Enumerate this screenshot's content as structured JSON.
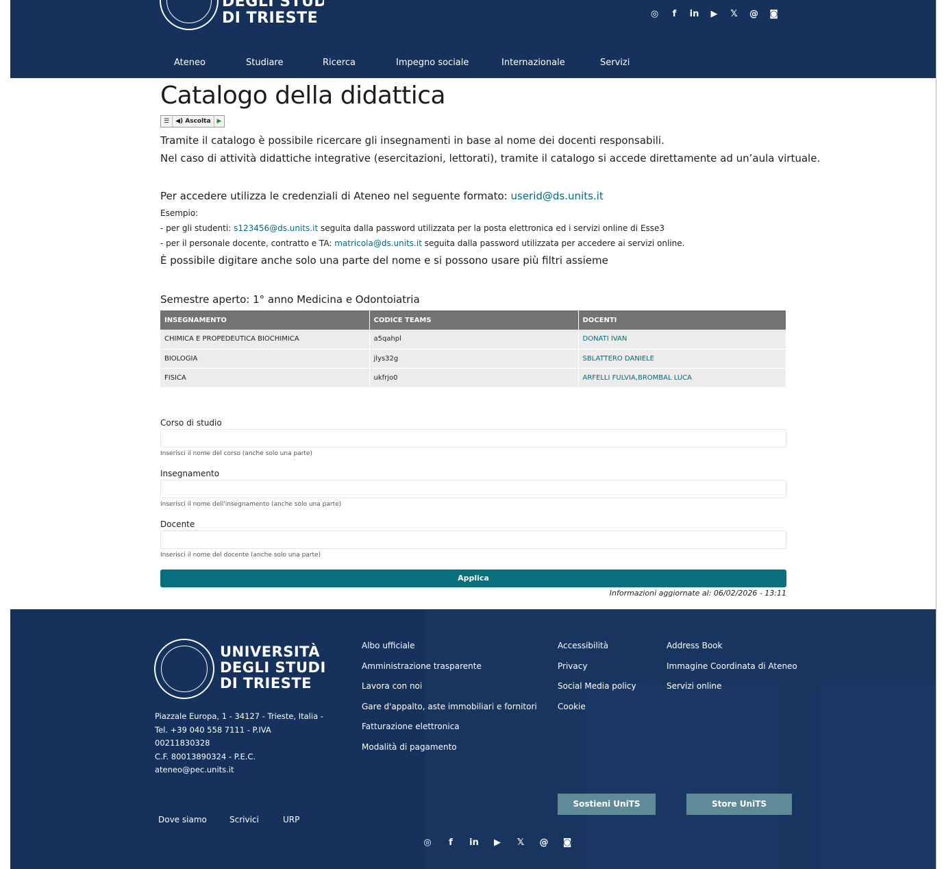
{
  "header": {
    "logo_text_line2": "DEGLI STUDI",
    "logo_text_line3": "DI TRIESTE",
    "social_icons": [
      "instagram-icon",
      "facebook-icon",
      "linkedin-icon",
      "youtube-icon",
      "x-icon",
      "threads-icon",
      "rss-icon"
    ],
    "social_glyphs": [
      "◎",
      "f",
      "in",
      "▶",
      "𝕏",
      "@",
      "◙"
    ],
    "nav": [
      "Ateneo",
      "Studiare",
      "Ricerca",
      "Impegno sociale",
      "Internazionale",
      "Servizi"
    ],
    "bg_color": "#16325c"
  },
  "page": {
    "title": "Catalogo della didattica",
    "player": {
      "menu_glyph": "☰",
      "listen_label": "◀) Ascolta",
      "play_glyph": "▶"
    },
    "intro1": "Tramite il catalogo è possibile ricercare gli insegnamenti in base al nome dei docenti responsabili.",
    "intro2": "Nel caso di attività didattiche integrative (esercitazioni, lettorati), tramite il catalogo si accede direttamente ad un’aula virtuale.",
    "access_prefix": "Per accedere utilizza le credenziali di Ateneo nel seguente formato: ",
    "access_link": "userid@ds.units.it",
    "example_label": "Esempio:",
    "ex1_prefix": "- per gli studenti: ",
    "ex1_link": "s123456@ds.units.it",
    "ex1_suffix": " seguita dalla password utilizzata per la posta elettronica ed i servizi online di Esse3",
    "ex2_prefix": "- per il personale docente, contratto e TA: ",
    "ex2_link": "matricola@ds.units.it",
    "ex2_suffix": " seguita dalla password utilizzata per accedere ai servizi online.",
    "hint": "È possibile digitare anche solo una parte del nome e si possono usare più filtri assieme"
  },
  "semester": {
    "title": "Semestre aperto: 1° anno Medicina e Odontoiatria",
    "columns": [
      "INSEGNAMENTO",
      "CODICE TEAMS",
      "DOCENTI"
    ],
    "rows": [
      {
        "course": "CHIMICA E PROPEDEUTICA BIOCHIMICA",
        "code": "a5qahpl",
        "teachers": "DONATI IVAN"
      },
      {
        "course": "BIOLOGIA",
        "code": "jlys32g",
        "teachers": "SBLATTERO DANIELE"
      },
      {
        "course": "FISICA",
        "code": "ukfrjo0",
        "teachers": "ARFELLI FULVIA,BROMBAL LUCA"
      }
    ]
  },
  "form": {
    "course_label": "Corso di studio",
    "course_value": "",
    "course_help": "Inserisci il nome del corso (anche solo una parte)",
    "subject_label": "Insegnamento",
    "subject_value": "",
    "subject_help": "Inserisci il nome dell'insegnamento (anche solo una parte)",
    "teacher_label": "Docente",
    "teacher_value": "",
    "teacher_help": "Inserisci il nome del docente (anche solo una parte)",
    "apply_label": "Applica",
    "updated": "Informazioni aggiornate al: 06/02/2026 - 13:11",
    "accent_color": "#086f7c"
  },
  "footer": {
    "logo_line1": "UNIVERSITÀ",
    "logo_line2": "DEGLI STUDI",
    "logo_line3": "DI TRIESTE",
    "address": [
      "Piazzale Europa, 1 - 34127 - Trieste, Italia -",
      "Tel. +39 040 558 7111 - P.IVA",
      "00211830328",
      "C.F. 80013890324 - P.E.C.",
      "ateneo@pec.units.it"
    ],
    "col1": [
      "Albo ufficiale",
      "Amministrazione trasparente",
      "Lavora con noi",
      "Gare d'appalto, aste immobiliari e fornitori",
      "Fatturazione elettronica",
      "Modalità di pagamento"
    ],
    "col2": [
      "Accessibilità",
      "Privacy",
      "Social Media policy",
      "Cookie"
    ],
    "col3": [
      "Address Book",
      "Immagine Coordinata di Ateneo",
      "Servizi online"
    ],
    "btn_support": "Sostieni UniTS",
    "btn_store": "Store UniTS",
    "bottom_links": [
      "Dove siamo",
      "Scrivici",
      "URP"
    ]
  }
}
